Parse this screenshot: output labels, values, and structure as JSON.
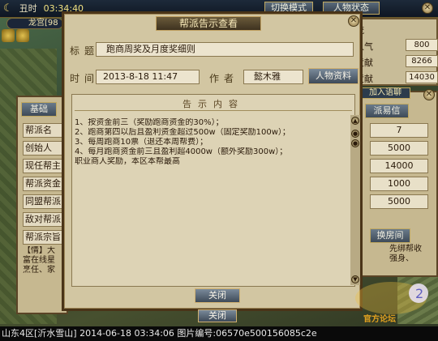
{
  "hud": {
    "time_period": "丑时",
    "time": "03:34:40",
    "location": "龙宫[98",
    "switch_mode": "切换模式",
    "character_status": "人物状态"
  },
  "stats": [
    {
      "label": "流",
      "value": ""
    },
    {
      "label": "人气",
      "value": "800"
    },
    {
      "label": "贡献",
      "value": "8266"
    },
    {
      "label": "贡献",
      "value": "14030"
    }
  ],
  "left_panel": {
    "tab": "基础",
    "labels": [
      "帮派名",
      "创始人",
      "现任帮主",
      "帮派资金",
      "同盟帮派",
      "敌对帮派",
      "帮派宗旨"
    ],
    "notice": "【情】大\n富在线星\n烹任、家"
  },
  "right_panel": {
    "header": "加入语聊",
    "tab": "派易信",
    "values": [
      "7",
      "5000",
      "14000",
      "1000",
      "5000"
    ],
    "room_btn": "换房间",
    "notice": "先绑帮收\n强身、"
  },
  "dialog": {
    "title": "帮派告示查看",
    "subject_label": "标题",
    "subject": "跑商周奖及月度奖细则",
    "time_label": "时间",
    "time": "2013-8-18 11:47",
    "author_label": "作者",
    "author": "懿木雅",
    "profile_button": "人物资料",
    "content_header": "告示内容",
    "content_lines": [
      "1、按资金前三（奖励跑商资金的30%）；",
      "2、跑商第四以后且盈利资金超过500w（固定奖励100w）；",
      "3、每周跑商10票（退还本周帮费）；",
      "4、每月跑商资金前三且盈利超4000w（额外奖励300w）；",
      "职业商人奖励，本区本帮最高"
    ],
    "close_button": "关闭"
  },
  "close_button_2": "关闭",
  "status_bar": "山东4区[沂水雪山] 2014-06-18 03:34:06 图片编号:06570e500156085c2e",
  "watermark": "官方论坛"
}
